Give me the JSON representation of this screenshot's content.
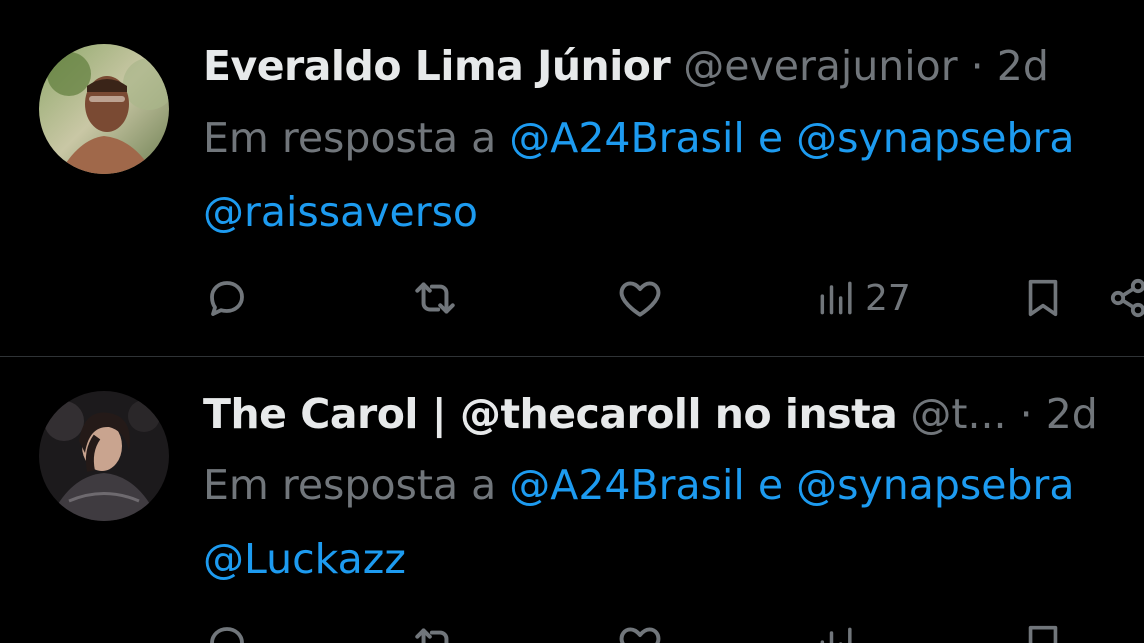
{
  "colors": {
    "background": "#000000",
    "primary_text": "#e7e9ea",
    "secondary_text": "#71767b",
    "link": "#1d9bf0",
    "divider": "#2f3336"
  },
  "tweets": [
    {
      "display_name": "Everaldo Lima Júnior",
      "handle": "@everajunior",
      "separator": "·",
      "time": "2d",
      "reply_prefix": "Em resposta a",
      "reply_mention_1": "@A24Brasil",
      "reply_joiner": "e",
      "reply_mention_2": "@synapsebra",
      "reply_mention_3": "@raissaverso",
      "views": "27",
      "icons": [
        "reply-icon",
        "retweet-icon",
        "like-icon",
        "views-icon",
        "bookmark-icon",
        "share-icon"
      ]
    },
    {
      "display_name": "The Carol | @thecaroll no insta",
      "handle": "@t...",
      "separator": "·",
      "time": "2d",
      "reply_prefix": "Em resposta a",
      "reply_mention_1": "@A24Brasil",
      "reply_joiner": "e",
      "reply_mention_2": "@synapsebra",
      "reply_mention_3": "@Luckazz",
      "views": "",
      "icons": [
        "reply-icon",
        "retweet-icon",
        "like-icon",
        "views-icon",
        "bookmark-icon"
      ]
    }
  ]
}
